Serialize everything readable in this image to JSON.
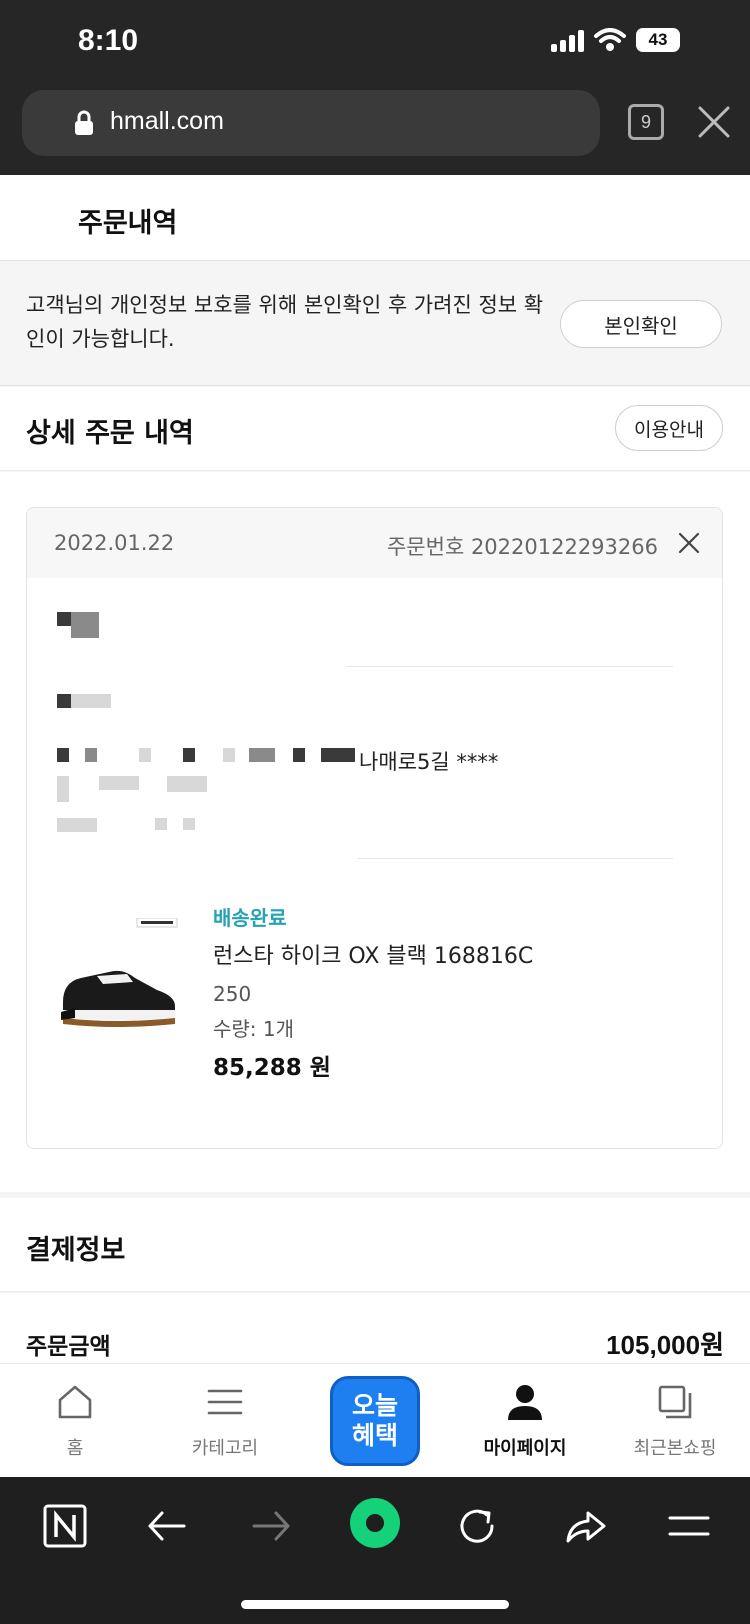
{
  "status_bar": {
    "time": "8:10",
    "battery": "43"
  },
  "browser": {
    "url": "hmall.com",
    "tab_count": "9"
  },
  "page": {
    "title": "주문내역"
  },
  "verify": {
    "notice": "고객님의 개인정보 보호를 위해 본인확인 후 가려진 정보 확인이 가능합니다.",
    "button_label": "본인확인"
  },
  "detail": {
    "title": "상세 주문 내역",
    "guide_label": "이용안내"
  },
  "order": {
    "date": "2022.01.22",
    "number_label": "주문번호 20220122293266",
    "address_tail": "나매로5길 ****",
    "item": {
      "status": "배송완료",
      "name": "런스타 하이크 OX 블랙 168816C",
      "size": "250",
      "quantity": "수량: 1개",
      "price": "85,288 원"
    }
  },
  "payment": {
    "title": "결제정보",
    "amount_label": "주문금액",
    "amount_value": "105,000원"
  },
  "app_nav": {
    "items": [
      {
        "label": "홈",
        "icon": "home-icon"
      },
      {
        "label": "카테고리",
        "icon": "menu-icon"
      },
      {
        "label": "오늘\n혜택",
        "icon": "promo-badge"
      },
      {
        "label": "마이페이지",
        "icon": "person-icon"
      },
      {
        "label": "최근본쇼핑",
        "icon": "recent-icon"
      }
    ],
    "promo_line1": "오늘",
    "promo_line2": "혜택"
  },
  "colors": {
    "accent_status": "#25a3b3",
    "promo_blue": "#1e7ff0",
    "browser_green": "#14d17a"
  }
}
